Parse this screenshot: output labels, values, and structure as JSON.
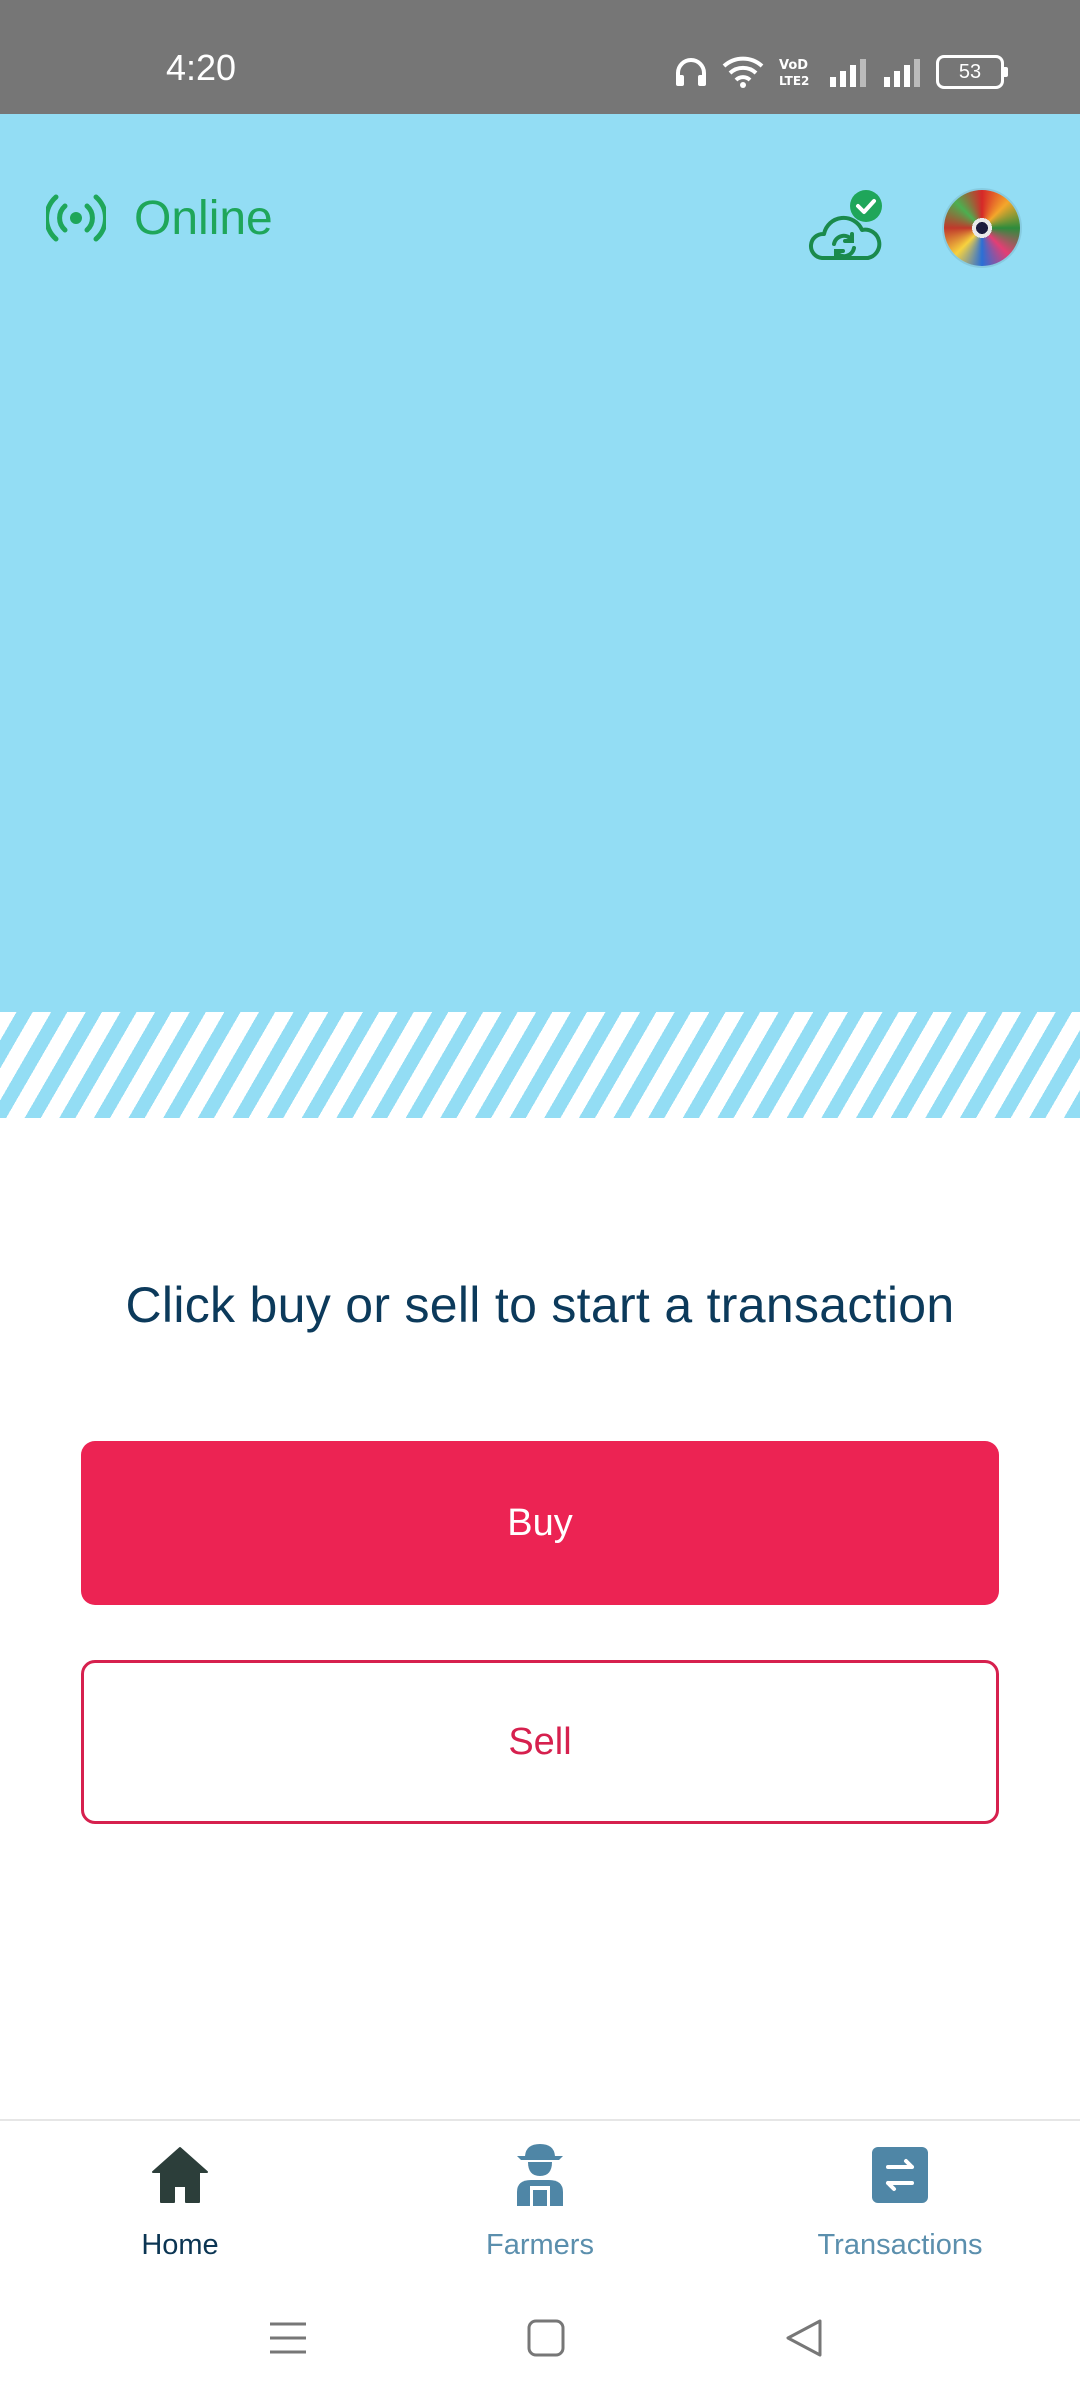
{
  "status_bar": {
    "time": "4:20",
    "battery": "53",
    "icons": [
      "headphones-icon",
      "wifi-icon",
      "volte-icon",
      "signal-icon",
      "signal-icon",
      "battery-icon"
    ]
  },
  "header": {
    "connection_status": "Online",
    "connection_icon": "broadcast-icon",
    "sync_icon": "cloud-sync-check-icon",
    "avatar": "profile-avatar"
  },
  "main": {
    "prompt": "Click buy or sell to start a transaction",
    "buy_label": "Buy",
    "sell_label": "Sell"
  },
  "bottom_nav": {
    "items": [
      {
        "label": "Home",
        "icon": "home-icon",
        "active": true
      },
      {
        "label": "Farmers",
        "icon": "farmer-icon",
        "active": false
      },
      {
        "label": "Transactions",
        "icon": "transfer-icon",
        "active": false
      }
    ]
  },
  "system_nav": {
    "icons": [
      "menu-icon",
      "home-square-icon",
      "back-triangle-icon"
    ]
  },
  "colors": {
    "hero_bg": "#93ddf4",
    "online_green": "#1fa65a",
    "buy_red": "#ec2353",
    "text_navy": "#0c3a5b",
    "nav_inactive": "#5b8fad"
  }
}
